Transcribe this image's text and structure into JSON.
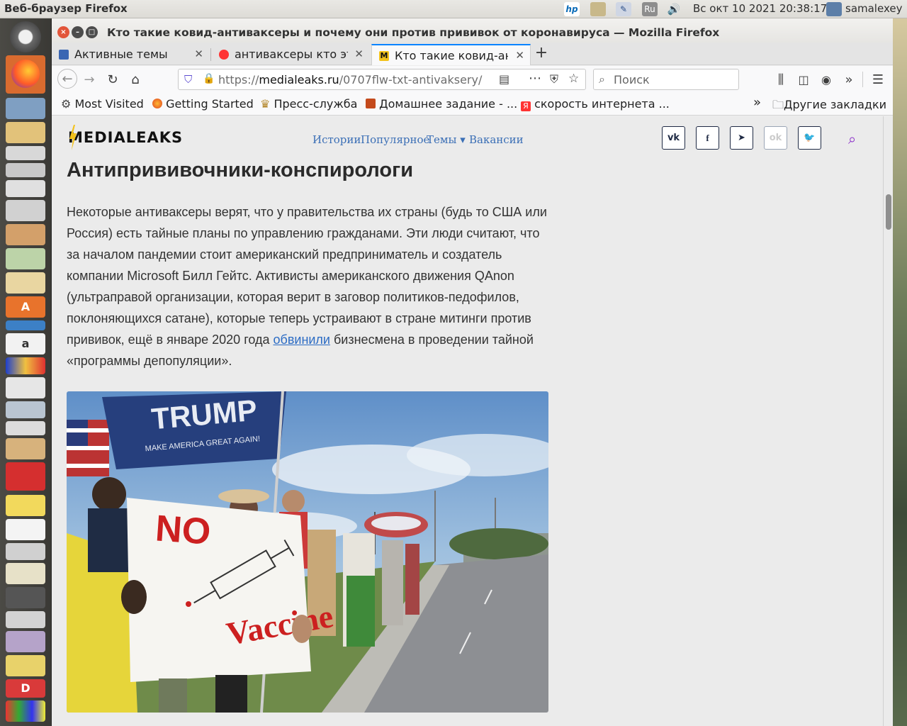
{
  "top_panel": {
    "app_name": "Веб-браузер Firefox",
    "keyboard_layout": "Ru",
    "clock": "Вс окт 10 2021 20:38:17",
    "user": "samalexey"
  },
  "window": {
    "title": "Кто такие ковид-антиваксеры и почему они против прививок от коронавируса — Mozilla Firefox"
  },
  "tabs": [
    {
      "label": "Активные темы",
      "icon": "discourse-icon"
    },
    {
      "label": "антиваксеры кто это",
      "icon": "yandex-icon"
    },
    {
      "label": "Кто такие ковид-антиваксеры",
      "icon": "medialeaks-icon"
    }
  ],
  "navbar": {
    "url_scheme": "https://",
    "url_host": "medialeaks.ru",
    "url_path": "/0707flw-txt-antivaksery/",
    "search_placeholder": "Поиск"
  },
  "bookmarks": [
    {
      "label": "Most Visited",
      "icon": "gear-icon"
    },
    {
      "label": "Getting Started",
      "icon": "firefox-icon"
    },
    {
      "label": "Пресс-служба",
      "icon": "emblem-icon"
    },
    {
      "label": "Домашнее задание - ...",
      "icon": "school-icon"
    },
    {
      "label": "скорость интернета ...",
      "icon": "yandex-icon"
    }
  ],
  "other_bookmarks": "Другие закладки",
  "site": {
    "logo": "MEDIALEAKS",
    "nav": [
      "Истории",
      "Популярное",
      "Темы ▾",
      "Вакансии"
    ],
    "social": [
      "vk",
      "f",
      "telegram",
      "ok",
      "twitter"
    ]
  },
  "article": {
    "heading": "Антипрививочники-конспирологи",
    "paragraph_before_link": "Некоторые антиваксеры верят, что у правительства их страны (будь то США или Россия) есть тайные планы по управлению гражданами. Эти люди считают, что за началом пандемии стоит американский предприниматель и создатель компании Microsoft Билл Гейтс. Активисты американского движения QAnon (ультраправой организации, которая верит в заговор политиков-педофилов, поклоняющихся сатане), которые теперь устраивают в стране митинги против прививок, ещё в январе 2020 года ",
    "link_text": "обвинили",
    "paragraph_after_link": " бизнесмена в проведении тайной «программы депопуляции».",
    "photo": {
      "flag_text": "TRUMP",
      "flag_subtext": "MAKE AMERICA GREAT AGAIN!",
      "sign_top": "NO",
      "sign_bottom": "Vaccine"
    }
  }
}
